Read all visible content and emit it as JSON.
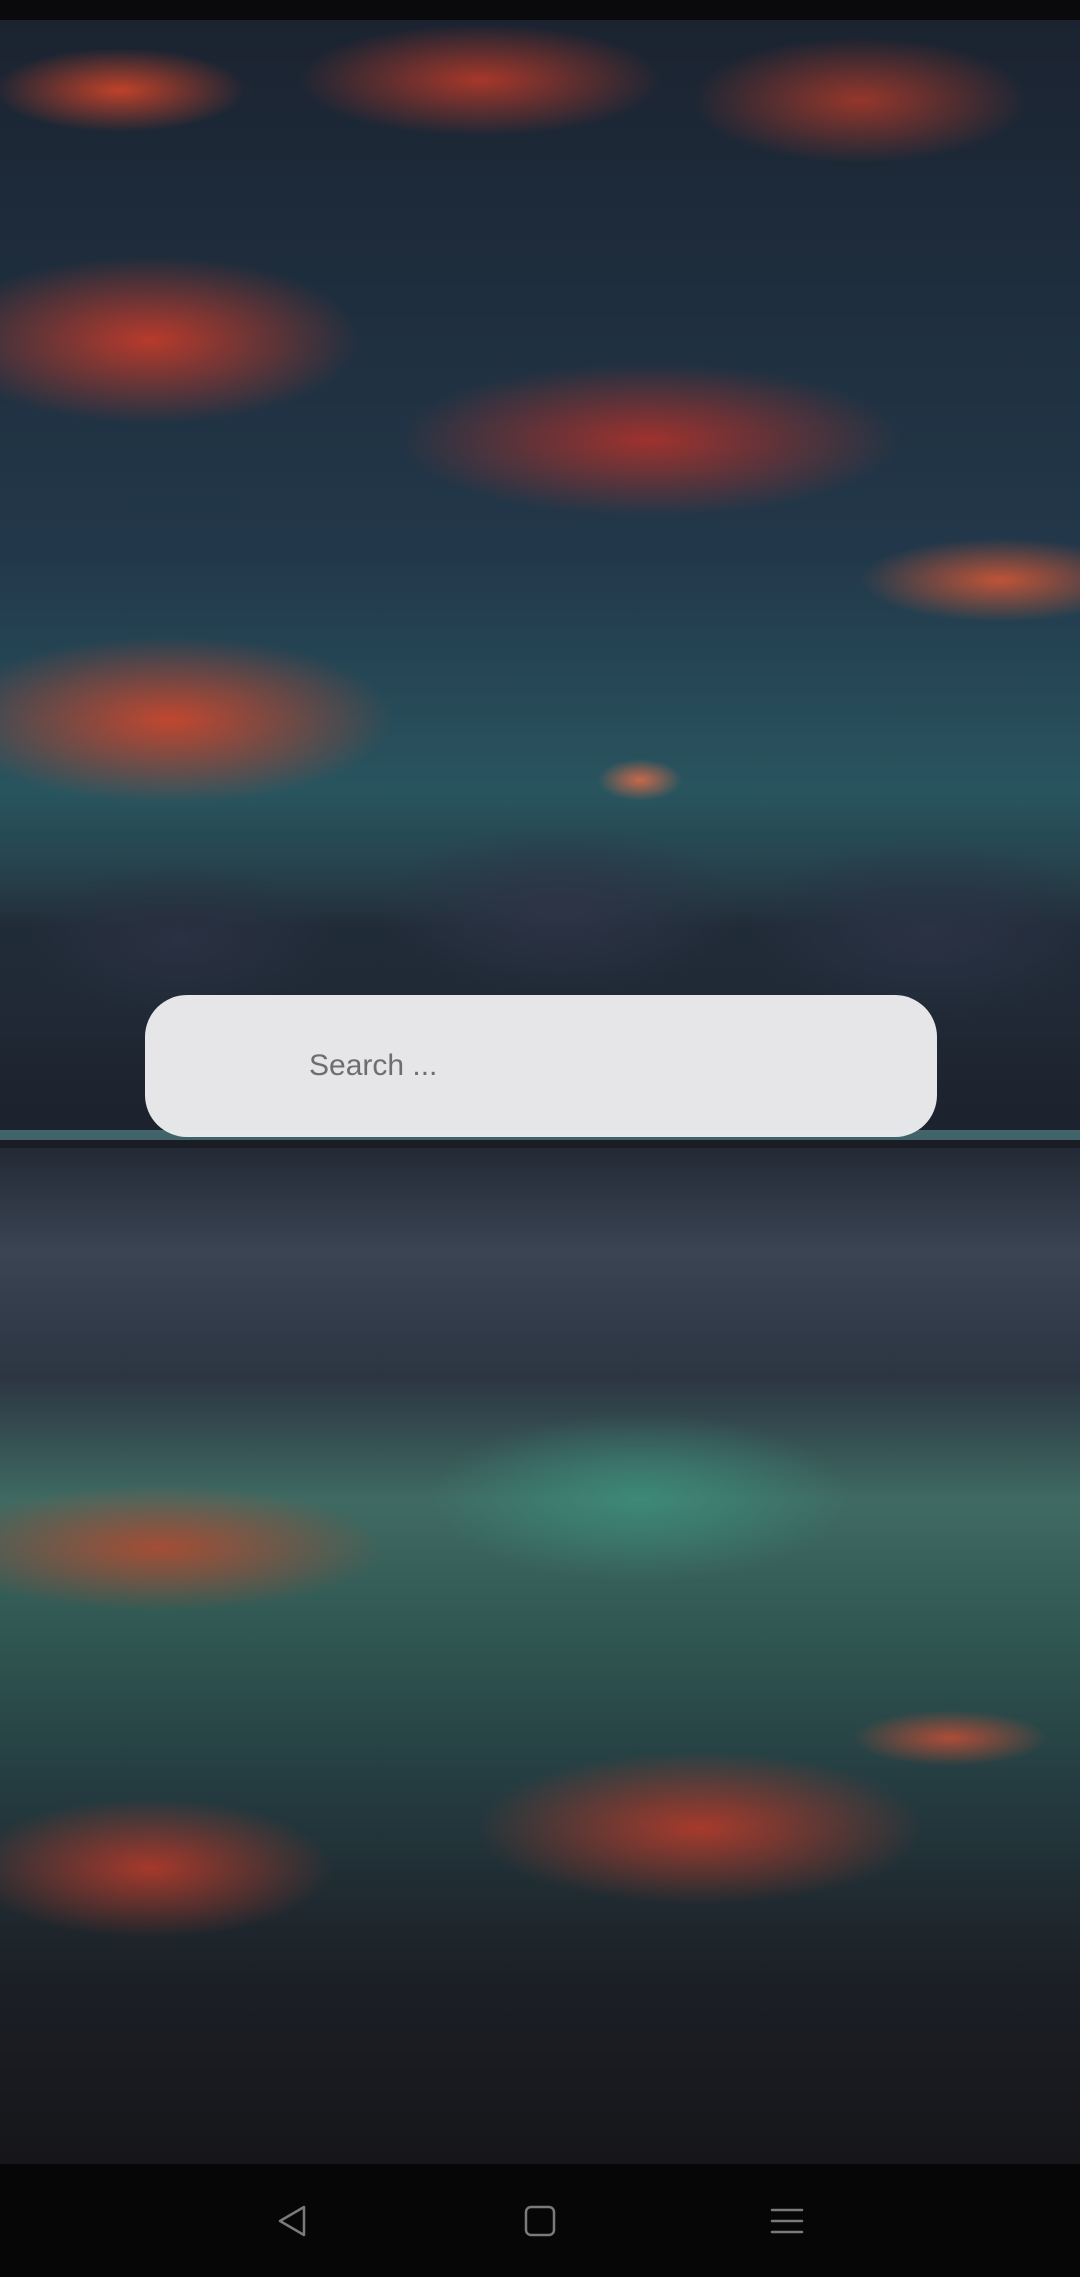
{
  "search": {
    "placeholder": "Search ..."
  },
  "navigation_bar": {
    "buttons": [
      {
        "name": "back",
        "icon": "back-triangle-icon"
      },
      {
        "name": "home",
        "icon": "home-square-icon"
      },
      {
        "name": "menu",
        "icon": "menu-lines-icon"
      }
    ],
    "icon_color": "#7a7a7a"
  },
  "colors": {
    "search_bar_background": "#ececee",
    "navigation_bar_background": "#060606",
    "placeholder_text": "#6e6e72"
  }
}
